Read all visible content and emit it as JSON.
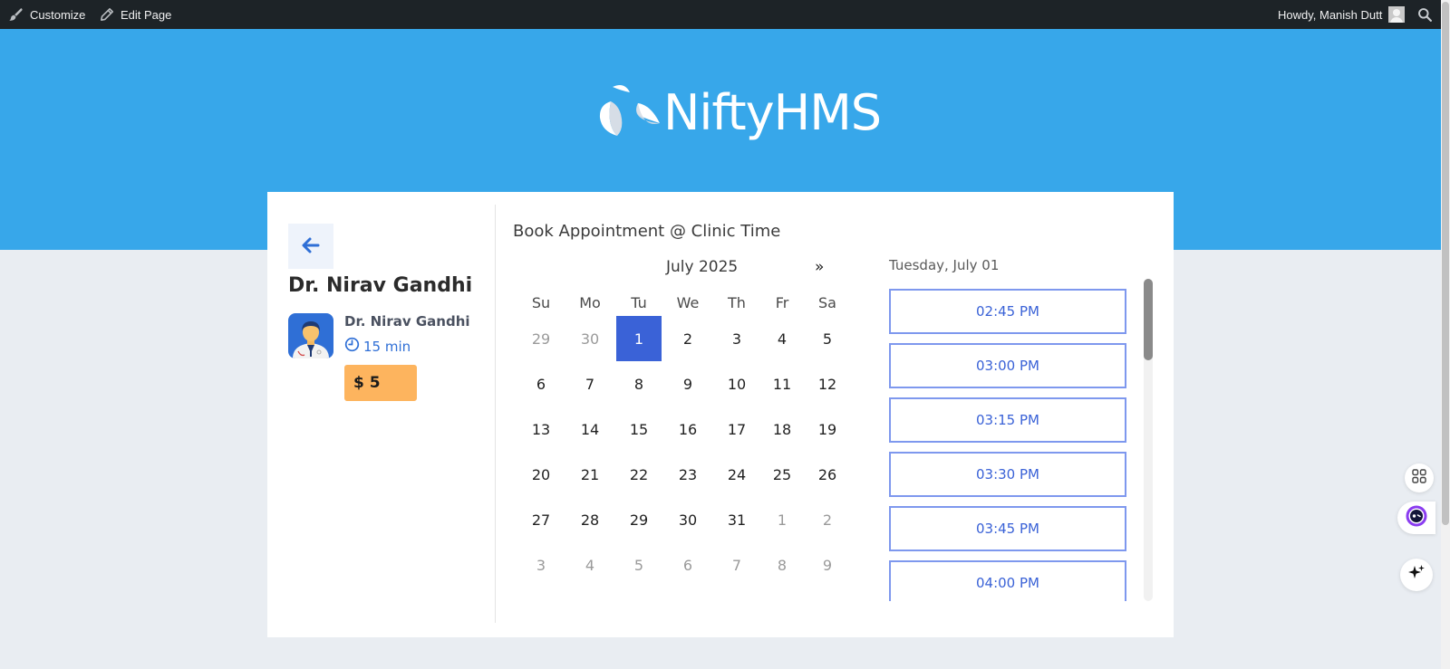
{
  "admin_bar": {
    "customize_label": "Customize",
    "edit_page_label": "Edit Page",
    "howdy_label": "Howdy, Manish Dutt"
  },
  "brand": {
    "name": "NiftyHMS"
  },
  "doctor": {
    "title": "Dr. Nirav Gandhi",
    "name": "Dr. Nirav Gandhi",
    "duration": "15 min",
    "price": "$ 5"
  },
  "booking": {
    "title": "Book Appointment @ Clinic Time",
    "month": "July 2025",
    "next_label": "»",
    "weekdays": [
      "Su",
      "Mo",
      "Tu",
      "We",
      "Th",
      "Fr",
      "Sa"
    ],
    "days": [
      {
        "label": "29",
        "muted": true
      },
      {
        "label": "30",
        "muted": true
      },
      {
        "label": "1",
        "selected": true
      },
      {
        "label": "2"
      },
      {
        "label": "3"
      },
      {
        "label": "4"
      },
      {
        "label": "5"
      },
      {
        "label": "6"
      },
      {
        "label": "7"
      },
      {
        "label": "8"
      },
      {
        "label": "9"
      },
      {
        "label": "10"
      },
      {
        "label": "11"
      },
      {
        "label": "12"
      },
      {
        "label": "13"
      },
      {
        "label": "14"
      },
      {
        "label": "15"
      },
      {
        "label": "16"
      },
      {
        "label": "17"
      },
      {
        "label": "18"
      },
      {
        "label": "19"
      },
      {
        "label": "20"
      },
      {
        "label": "21"
      },
      {
        "label": "22"
      },
      {
        "label": "23"
      },
      {
        "label": "24"
      },
      {
        "label": "25"
      },
      {
        "label": "26"
      },
      {
        "label": "27"
      },
      {
        "label": "28"
      },
      {
        "label": "29"
      },
      {
        "label": "30"
      },
      {
        "label": "31"
      },
      {
        "label": "1",
        "muted": true
      },
      {
        "label": "2",
        "muted": true
      },
      {
        "label": "3",
        "muted": true
      },
      {
        "label": "4",
        "muted": true
      },
      {
        "label": "5",
        "muted": true
      },
      {
        "label": "6",
        "muted": true
      },
      {
        "label": "7",
        "muted": true
      },
      {
        "label": "8",
        "muted": true
      },
      {
        "label": "9",
        "muted": true
      }
    ],
    "selected_date_label": "Tuesday, July 01",
    "time_slots": [
      "02:45 PM",
      "03:00 PM",
      "03:15 PM",
      "03:30 PM",
      "03:45 PM",
      "04:00 PM"
    ]
  },
  "colors": {
    "hero": "#37a7ea",
    "accent": "#3a62d7",
    "price_bg": "#fdb45e",
    "admin_bar": "#1d2327"
  },
  "icons": [
    "paintbrush-icon",
    "pencil-icon",
    "user-avatar-icon",
    "search-icon",
    "brand-logo-icon",
    "arrow-left-icon",
    "doctor-avatar",
    "clock-icon",
    "apps-grid-icon",
    "assistant-icon",
    "sparkle-icon"
  ]
}
